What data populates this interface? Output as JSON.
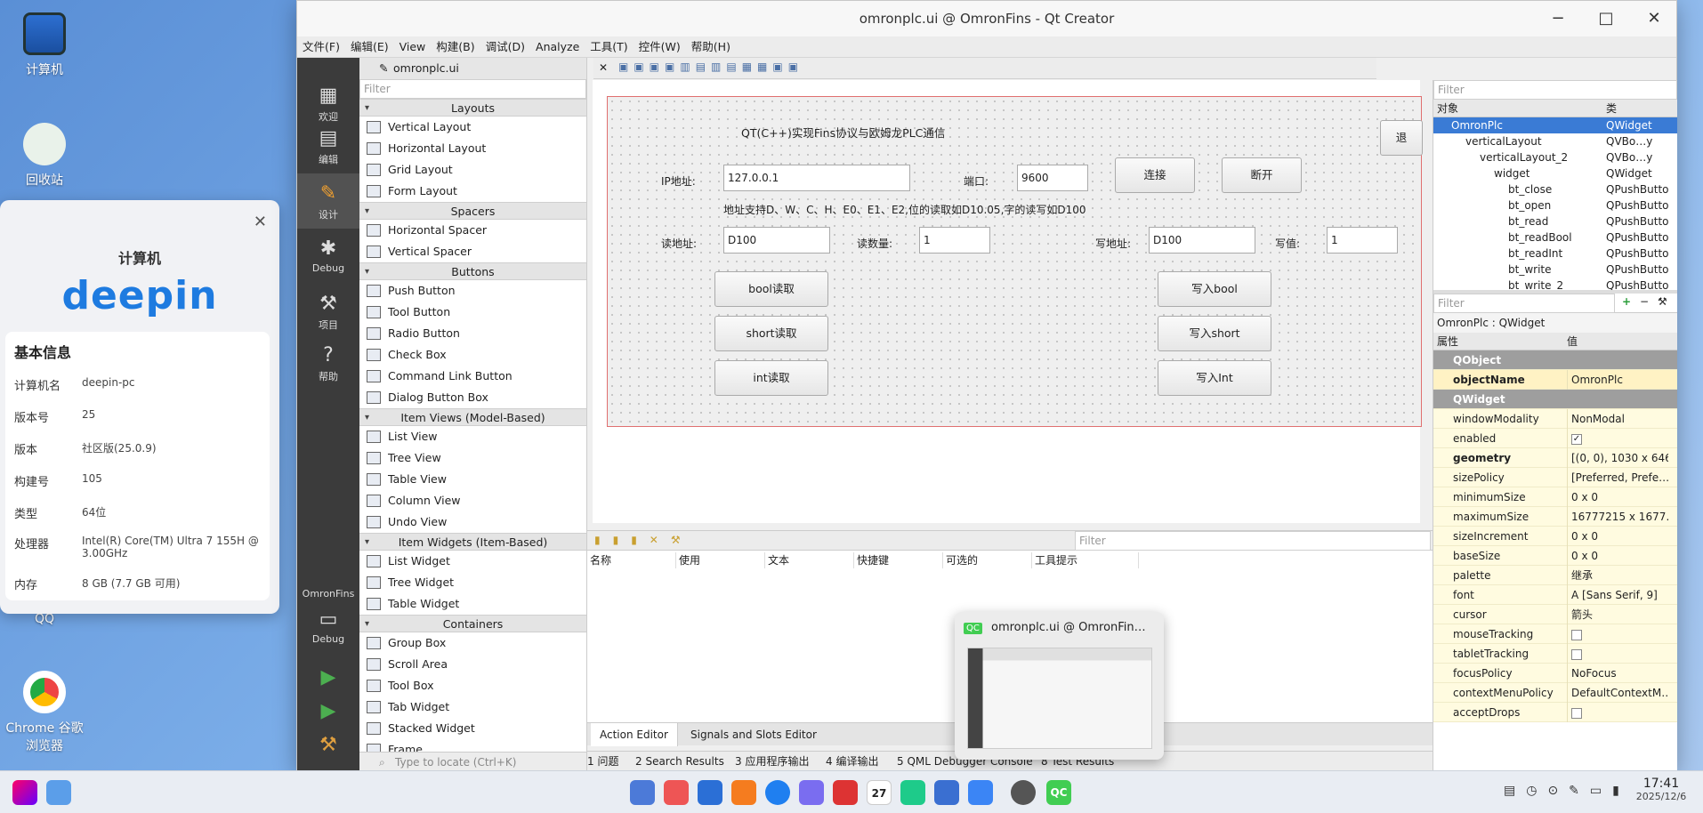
{
  "desktop": {
    "icons": [
      {
        "label": "计算机",
        "icon": "computer-icon"
      },
      {
        "label": "回收站",
        "icon": "trash-icon"
      },
      {
        "label": "QQ",
        "icon": "qq-icon"
      },
      {
        "label": "Chrome 谷歌浏览器",
        "icon": "chrome-icon"
      }
    ]
  },
  "sysinfo": {
    "title": "计算机",
    "logo_text": "deepin",
    "section": "基本信息",
    "rows": [
      {
        "k": "计算机名",
        "v": "deepin-pc"
      },
      {
        "k": "版本号",
        "v": "25"
      },
      {
        "k": "版本",
        "v": "社区版(25.0.9)"
      },
      {
        "k": "构建号",
        "v": "105"
      },
      {
        "k": "类型",
        "v": "64位"
      },
      {
        "k": "处理器",
        "v": "Intel(R) Core(TM) Ultra 7 155H @ 3.00GHz"
      },
      {
        "k": "内存",
        "v": "8 GB (7.7 GB 可用)"
      }
    ]
  },
  "window": {
    "title": "omronplc.ui @ OmronFins - Qt Creator",
    "menu": [
      "文件(F)",
      "编辑(E)",
      "View",
      "构建(B)",
      "调试(D)",
      "Analyze",
      "工具(T)",
      "控件(W)",
      "帮助(H)"
    ],
    "open_file": "omronplc.ui",
    "modes": [
      {
        "label": "欢迎",
        "icon": "grid-icon"
      },
      {
        "label": "编辑",
        "icon": "document-icon"
      },
      {
        "label": "设计",
        "icon": "pen-icon"
      },
      {
        "label": "Debug",
        "icon": "bug-icon"
      },
      {
        "label": "项目",
        "icon": "wrench-icon"
      },
      {
        "label": "帮助",
        "icon": "help-icon"
      }
    ],
    "kit": {
      "project": "OmronFins",
      "config": "Debug"
    }
  },
  "widgetbox": {
    "filter": "Filter",
    "categories": [
      {
        "name": "Layouts",
        "items": [
          "Vertical Layout",
          "Horizontal Layout",
          "Grid Layout",
          "Form Layout"
        ]
      },
      {
        "name": "Spacers",
        "items": [
          "Horizontal Spacer",
          "Vertical Spacer"
        ]
      },
      {
        "name": "Buttons",
        "items": [
          "Push Button",
          "Tool Button",
          "Radio Button",
          "Check Box",
          "Command Link Button",
          "Dialog Button Box"
        ]
      },
      {
        "name": "Item Views (Model-Based)",
        "items": [
          "List View",
          "Tree View",
          "Table View",
          "Column View",
          "Undo View"
        ]
      },
      {
        "name": "Item Widgets (Item-Based)",
        "items": [
          "List Widget",
          "Tree Widget",
          "Table Widget"
        ]
      },
      {
        "name": "Containers",
        "items": [
          "Group Box",
          "Scroll Area",
          "Tool Box",
          "Tab Widget",
          "Stacked Widget",
          "Frame"
        ]
      }
    ]
  },
  "form": {
    "heading": "QT(C++)实现Fins协议与欧姆龙PLC通信",
    "ip_label": "IP地址:",
    "ip_value": "127.0.0.1",
    "port_label": "端口:",
    "port_value": "9600",
    "connect": "连接",
    "disconnect": "断开",
    "hint": "地址支持D、W、C、H、E0、E1、E2,位的读取如D10.05,字的读写如D100",
    "read_addr_label": "读地址:",
    "read_addr_value": "D100",
    "read_count_label": "读数量:",
    "read_count_value": "1",
    "write_addr_label": "写地址:",
    "write_addr_value": "D100",
    "write_val_label": "写值:",
    "write_val_value": "1",
    "btn_bool_read": "bool读取",
    "btn_short_read": "short读取",
    "btn_int_read": "int读取",
    "btn_bool_write": "写入bool",
    "btn_short_write": "写入short",
    "btn_int_write": "写入Int",
    "right_edge_btn": "退"
  },
  "object_inspector": {
    "filter": "Filter",
    "col_obj": "对象",
    "col_class": "类",
    "rows": [
      {
        "name": "OmronPlc",
        "cls": "QWidget",
        "depth": 0
      },
      {
        "name": "verticalLayout",
        "cls": "QVBo…y",
        "depth": 1
      },
      {
        "name": "verticalLayout_2",
        "cls": "QVBo…y",
        "depth": 2
      },
      {
        "name": "widget",
        "cls": "QWidget",
        "depth": 3
      },
      {
        "name": "bt_close",
        "cls": "QPushButto",
        "depth": 4
      },
      {
        "name": "bt_open",
        "cls": "QPushButto",
        "depth": 4
      },
      {
        "name": "bt_read",
        "cls": "QPushButto",
        "depth": 4
      },
      {
        "name": "bt_readBool",
        "cls": "QPushButto",
        "depth": 4
      },
      {
        "name": "bt_readInt",
        "cls": "QPushButto",
        "depth": 4
      },
      {
        "name": "bt_write",
        "cls": "QPushButto",
        "depth": 4
      },
      {
        "name": "bt_write_2",
        "cls": "QPushButto",
        "depth": 4
      }
    ]
  },
  "property_editor": {
    "filter": "Filter",
    "context": "OmronPlc : QWidget",
    "col_prop": "属性",
    "col_val": "值",
    "rows": [
      {
        "n": "QObject",
        "v": "",
        "grp": true
      },
      {
        "n": "objectName",
        "v": "OmronPlc",
        "bold": true
      },
      {
        "n": "QWidget",
        "v": "",
        "grp": true
      },
      {
        "n": "windowModality",
        "v": "NonModal"
      },
      {
        "n": "enabled",
        "v": "✓",
        "chk": true
      },
      {
        "n": "geometry",
        "v": "[(0, 0), 1030 x 646]",
        "bold": true
      },
      {
        "n": "sizePolicy",
        "v": "[Preferred, Prefe…"
      },
      {
        "n": "minimumSize",
        "v": "0 x 0"
      },
      {
        "n": "maximumSize",
        "v": "16777215 x 1677…"
      },
      {
        "n": "sizeIncrement",
        "v": "0 x 0"
      },
      {
        "n": "baseSize",
        "v": "0 x 0"
      },
      {
        "n": "palette",
        "v": "继承"
      },
      {
        "n": "font",
        "v": "A [Sans Serif, 9]"
      },
      {
        "n": "cursor",
        "v": "箭头"
      },
      {
        "n": "mouseTracking",
        "v": "",
        "chk": true
      },
      {
        "n": "tabletTracking",
        "v": "",
        "chk": true
      },
      {
        "n": "focusPolicy",
        "v": "NoFocus"
      },
      {
        "n": "contextMenuPolicy",
        "v": "DefaultContextM…"
      },
      {
        "n": "acceptDrops",
        "v": "",
        "chk": true
      }
    ]
  },
  "action_editor": {
    "filter": "Filter",
    "columns": [
      "名称",
      "使用",
      "文本",
      "快捷键",
      "可选的",
      "工具提示"
    ],
    "tabs": [
      "Action Editor",
      "Signals and Slots Editor"
    ]
  },
  "output_bar": {
    "locate_placeholder": "Type to locate (Ctrl+K)",
    "items": [
      "1 问题",
      "2 Search Results",
      "3 应用程序输出",
      "4 编译输出",
      "5 QML Debugger Console",
      "8 Test Results"
    ]
  },
  "thumbnail": {
    "title": "omronplc.ui @ OmronFin…"
  },
  "taskbar": {
    "time": "17:41",
    "date": "2025/12/6",
    "calendar_day": "27"
  },
  "colors": {
    "accent": "#3a7bd5",
    "modebar": "#3b3b3b",
    "deepin": "#1e7be0"
  }
}
